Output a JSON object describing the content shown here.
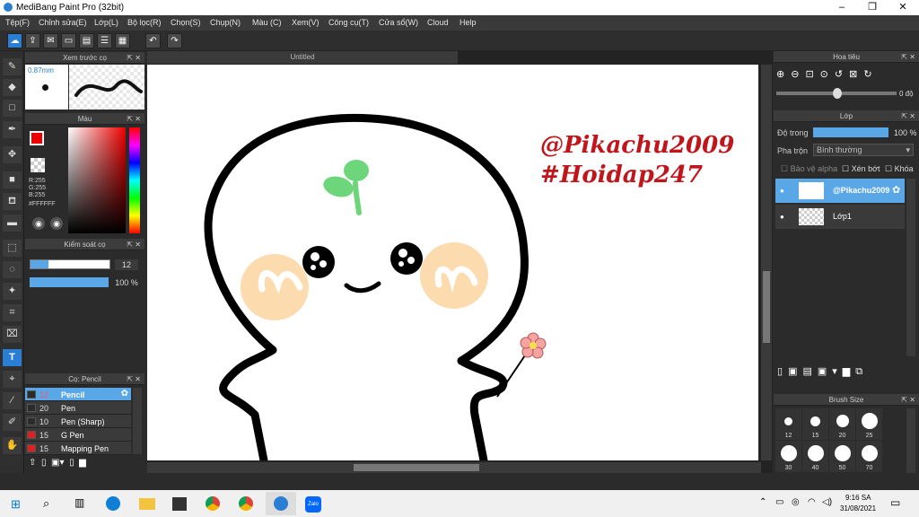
{
  "window": {
    "title": "MediBang Paint Pro (32bit)",
    "min": "–",
    "max": "❐",
    "close": "✕"
  },
  "menu": [
    "Tệp(F)",
    "Chỉnh sửa(E)",
    "Lớp(L)",
    "Bộ lọc(R)",
    "Chọn(S)",
    "Chụp(N)",
    "Màu (C)",
    "Xem(V)",
    "Công cụ(T)",
    "Cửa sổ(W)",
    "Cloud",
    "Help"
  ],
  "document": {
    "tab": "Untitled"
  },
  "preview": {
    "title": "Xem trước cọ",
    "size": "0.87mm"
  },
  "color": {
    "title": "Màu",
    "r": "R:255",
    "g": "G:255",
    "b": "B:255",
    "hex": "#FFFFFF",
    "main": "#ff0000"
  },
  "brushcontrol": {
    "title": "Kiểm soát cọ",
    "size": "12",
    "opacity": "100 %"
  },
  "brushes": {
    "title": "Cọ: Pencil",
    "items": [
      {
        "n": "12",
        "name": "Pencil",
        "c": "#2b2b2b",
        "sel": true
      },
      {
        "n": "20",
        "name": "Pen",
        "c": "#2b2b2b"
      },
      {
        "n": "10",
        "name": "Pen (Sharp)",
        "c": "#2b2b2b"
      },
      {
        "n": "15",
        "name": "G Pen",
        "c": "#e02020"
      },
      {
        "n": "15",
        "name": "Mapping Pen",
        "c": "#e02020"
      }
    ]
  },
  "navigator": {
    "title": "Hoa tiêu",
    "angle": "0 độ"
  },
  "layer": {
    "title": "Lớp",
    "opacity_label": "Độ trong",
    "opacity": "100 %",
    "blend_label": "Pha trộn",
    "blend": "Bình thường",
    "protect": "Bảo vệ alpha",
    "clip": "Xén bớt",
    "lock": "Khóa",
    "items": [
      {
        "name": "@Pikachu2009",
        "sel": true
      },
      {
        "name": "Lớp1",
        "sel": false
      }
    ]
  },
  "brushsize": {
    "title": "Brush Size",
    "sizes": [
      "12",
      "15",
      "20",
      "25",
      "30",
      "40",
      "50",
      "70"
    ]
  },
  "art": {
    "line1": "@Pikachu2009",
    "line2": "#Hoidap247"
  },
  "taskbar": {
    "time": "9:16 SA",
    "date": "31/08/2021",
    "zalo": "Zalo"
  }
}
